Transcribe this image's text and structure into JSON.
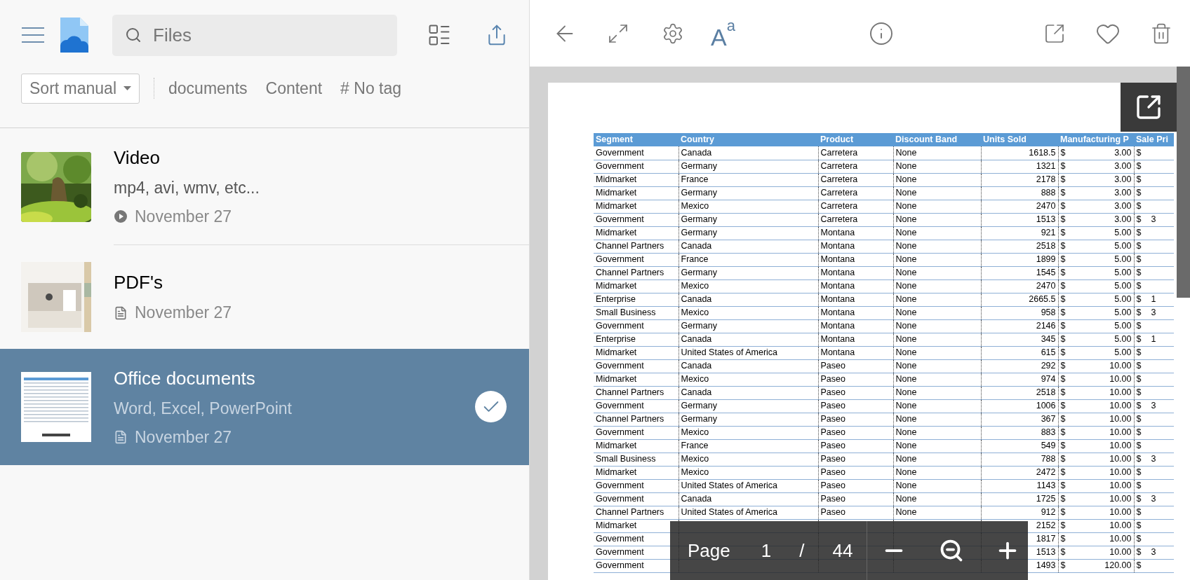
{
  "sidebar": {
    "search": {
      "placeholder": "Files"
    },
    "filters": {
      "sort": "Sort manual",
      "chips": [
        "documents",
        "Content"
      ],
      "tags": {
        "glyph": "#",
        "label": "No tag"
      }
    },
    "items": [
      {
        "title": "Video",
        "subtitle": "mp4, avi, wmv, etc...",
        "date": "November 27",
        "kind": "video",
        "selected": false
      },
      {
        "title": "PDF's",
        "date": "November 27",
        "kind": "document",
        "selected": false
      },
      {
        "title": "Office documents",
        "subtitle": "Word, Excel, PowerPoint",
        "date": "November 27",
        "kind": "document",
        "selected": true
      }
    ]
  },
  "viewer": {
    "toolbar": {
      "font_button": {
        "letter": "A",
        "superscript": "a"
      }
    },
    "table": {
      "columns": [
        "Segment",
        "Country",
        "Product",
        "Discount Band",
        "Units Sold",
        "Manufacturing P",
        "Sale Pri"
      ],
      "rows": [
        [
          "Government",
          "Canada",
          "Carretera",
          "None",
          "1618.5",
          [
            "$",
            "3.00"
          ],
          [
            "$"
          ]
        ],
        [
          "Government",
          "Germany",
          "Carretera",
          "None",
          "1321",
          [
            "$",
            "3.00"
          ],
          [
            "$"
          ]
        ],
        [
          "Midmarket",
          "France",
          "Carretera",
          "None",
          "2178",
          [
            "$",
            "3.00"
          ],
          [
            "$"
          ]
        ],
        [
          "Midmarket",
          "Germany",
          "Carretera",
          "None",
          "888",
          [
            "$",
            "3.00"
          ],
          [
            "$"
          ]
        ],
        [
          "Midmarket",
          "Mexico",
          "Carretera",
          "None",
          "2470",
          [
            "$",
            "3.00"
          ],
          [
            "$"
          ]
        ],
        [
          "Government",
          "Germany",
          "Carretera",
          "None",
          "1513",
          [
            "$",
            "3.00"
          ],
          [
            "$",
            "3"
          ]
        ],
        [
          "Midmarket",
          "Germany",
          "Montana",
          "None",
          "921",
          [
            "$",
            "5.00"
          ],
          [
            "$"
          ]
        ],
        [
          "Channel Partners",
          "Canada",
          "Montana",
          "None",
          "2518",
          [
            "$",
            "5.00"
          ],
          [
            "$"
          ]
        ],
        [
          "Government",
          "France",
          "Montana",
          "None",
          "1899",
          [
            "$",
            "5.00"
          ],
          [
            "$"
          ]
        ],
        [
          "Channel Partners",
          "Germany",
          "Montana",
          "None",
          "1545",
          [
            "$",
            "5.00"
          ],
          [
            "$"
          ]
        ],
        [
          "Midmarket",
          "Mexico",
          "Montana",
          "None",
          "2470",
          [
            "$",
            "5.00"
          ],
          [
            "$"
          ]
        ],
        [
          "Enterprise",
          "Canada",
          "Montana",
          "None",
          "2665.5",
          [
            "$",
            "5.00"
          ],
          [
            "$",
            "1"
          ]
        ],
        [
          "Small Business",
          "Mexico",
          "Montana",
          "None",
          "958",
          [
            "$",
            "5.00"
          ],
          [
            "$",
            "3"
          ]
        ],
        [
          "Government",
          "Germany",
          "Montana",
          "None",
          "2146",
          [
            "$",
            "5.00"
          ],
          [
            "$"
          ]
        ],
        [
          "Enterprise",
          "Canada",
          "Montana",
          "None",
          "345",
          [
            "$",
            "5.00"
          ],
          [
            "$",
            "1"
          ]
        ],
        [
          "Midmarket",
          "United States of America",
          "Montana",
          "None",
          "615",
          [
            "$",
            "5.00"
          ],
          [
            "$"
          ]
        ],
        [
          "Government",
          "Canada",
          "Paseo",
          "None",
          "292",
          [
            "$",
            "10.00"
          ],
          [
            "$"
          ]
        ],
        [
          "Midmarket",
          "Mexico",
          "Paseo",
          "None",
          "974",
          [
            "$",
            "10.00"
          ],
          [
            "$"
          ]
        ],
        [
          "Channel Partners",
          "Canada",
          "Paseo",
          "None",
          "2518",
          [
            "$",
            "10.00"
          ],
          [
            "$"
          ]
        ],
        [
          "Government",
          "Germany",
          "Paseo",
          "None",
          "1006",
          [
            "$",
            "10.00"
          ],
          [
            "$",
            "3"
          ]
        ],
        [
          "Channel Partners",
          "Germany",
          "Paseo",
          "None",
          "367",
          [
            "$",
            "10.00"
          ],
          [
            "$"
          ]
        ],
        [
          "Government",
          "Mexico",
          "Paseo",
          "None",
          "883",
          [
            "$",
            "10.00"
          ],
          [
            "$"
          ]
        ],
        [
          "Midmarket",
          "France",
          "Paseo",
          "None",
          "549",
          [
            "$",
            "10.00"
          ],
          [
            "$"
          ]
        ],
        [
          "Small Business",
          "Mexico",
          "Paseo",
          "None",
          "788",
          [
            "$",
            "10.00"
          ],
          [
            "$",
            "3"
          ]
        ],
        [
          "Midmarket",
          "Mexico",
          "Paseo",
          "None",
          "2472",
          [
            "$",
            "10.00"
          ],
          [
            "$"
          ]
        ],
        [
          "Government",
          "United States of America",
          "Paseo",
          "None",
          "1143",
          [
            "$",
            "10.00"
          ],
          [
            "$"
          ]
        ],
        [
          "Government",
          "Canada",
          "Paseo",
          "None",
          "1725",
          [
            "$",
            "10.00"
          ],
          [
            "$",
            "3"
          ]
        ],
        [
          "Channel Partners",
          "United States of America",
          "Paseo",
          "None",
          "912",
          [
            "$",
            "10.00"
          ],
          [
            "$"
          ]
        ],
        [
          "Midmarket",
          null,
          null,
          null,
          "2152",
          [
            "$",
            "10.00"
          ],
          [
            "$"
          ]
        ],
        [
          "Government",
          null,
          null,
          null,
          "1817",
          [
            "$",
            "10.00"
          ],
          [
            "$"
          ]
        ],
        [
          "Government",
          null,
          null,
          null,
          "1513",
          [
            "$",
            "10.00"
          ],
          [
            "$",
            "3"
          ]
        ],
        [
          "Government",
          null,
          null,
          null,
          "1493",
          [
            "$",
            "120.00"
          ],
          [
            "$"
          ]
        ]
      ]
    },
    "pager": {
      "label": "Page",
      "current": "1",
      "separator": "/",
      "total": "44"
    }
  }
}
